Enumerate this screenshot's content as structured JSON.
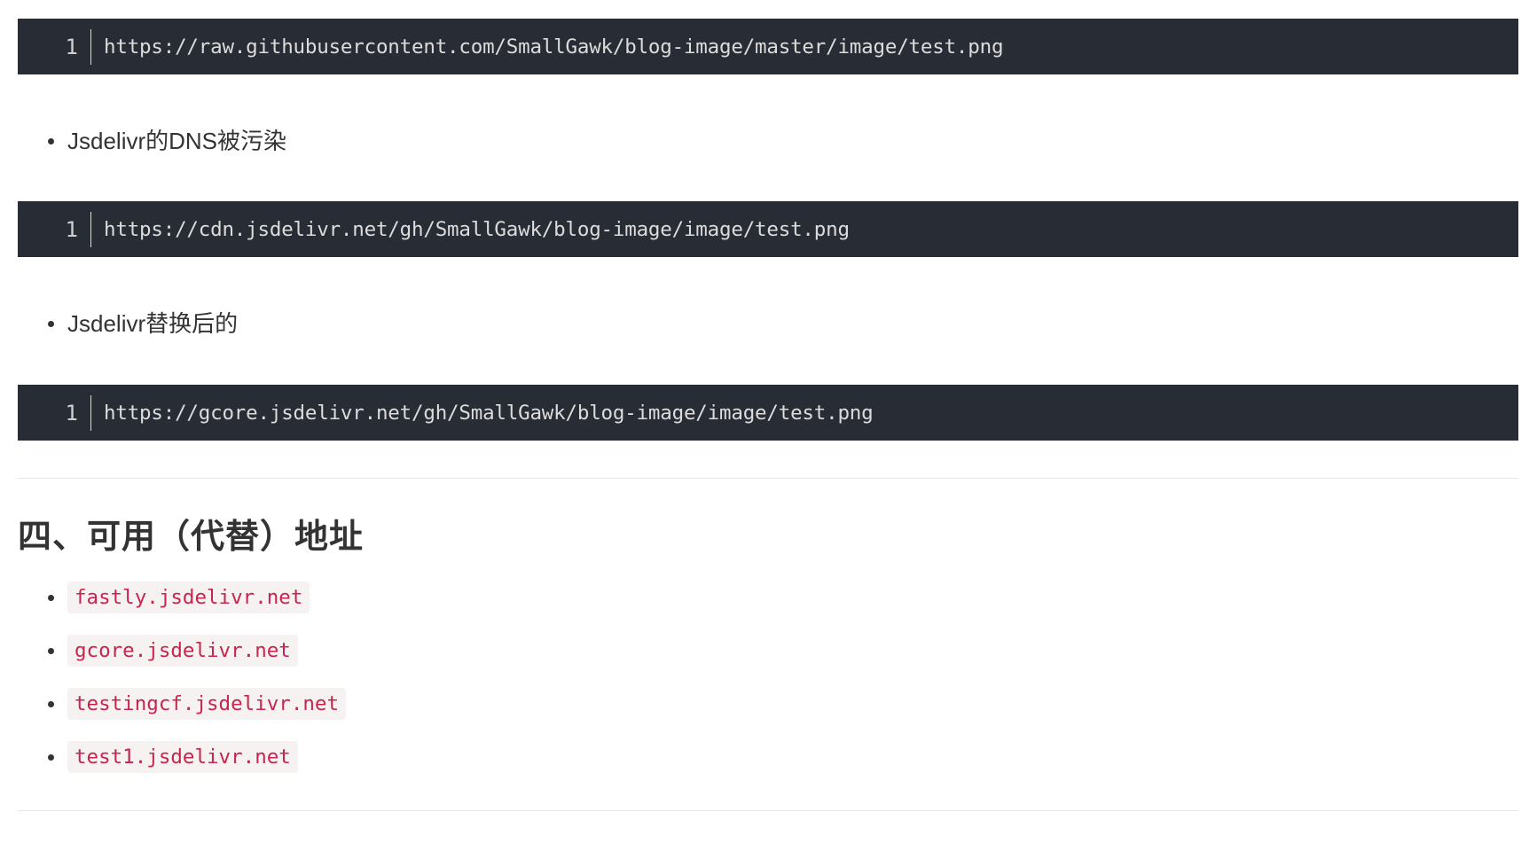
{
  "code_blocks": [
    {
      "line": "1",
      "code": "https://raw.githubusercontent.com/SmallGawk/blog-image/master/image/test.png"
    },
    {
      "line": "1",
      "code": "https://cdn.jsdelivr.net/gh/SmallGawk/blog-image/image/test.png"
    },
    {
      "line": "1",
      "code": "https://gcore.jsdelivr.net/gh/SmallGawk/blog-image/image/test.png"
    }
  ],
  "bullets": [
    "Jsdelivr的DNS被污染",
    "Jsdelivr替换后的"
  ],
  "section": {
    "title": "四、可用（代替）地址",
    "links": [
      "fastly.jsdelivr.net",
      "gcore.jsdelivr.net",
      "testingcf.jsdelivr.net",
      "test1.jsdelivr.net"
    ]
  },
  "colors": {
    "code_bg": "#282c34",
    "inline_code_fg": "#c7254e",
    "inline_code_bg": "#f6f2f2",
    "text": "#333333"
  }
}
